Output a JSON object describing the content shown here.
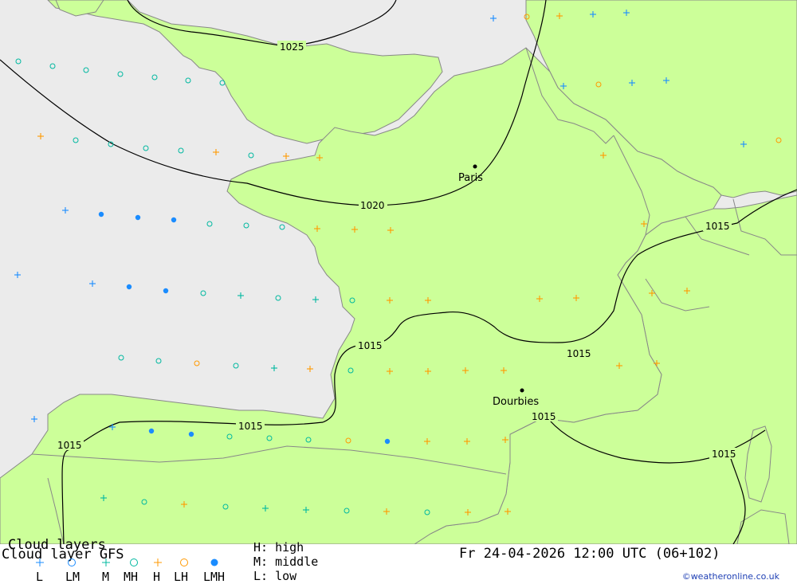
{
  "map": {
    "colors": {
      "sea": "#ebebeb",
      "land": "#ccff99",
      "border": "#888888",
      "isobar": "#000000",
      "low": "#1a8cff",
      "mid": "#00b8a0",
      "high": "#ff9900"
    },
    "cities": [
      {
        "name": "Paris"
      },
      {
        "name": "Dourbies"
      }
    ],
    "isobar_labels": [
      "1025",
      "1020",
      "1015",
      "1015",
      "1015",
      "1015",
      "1015",
      "1015",
      "1015"
    ]
  },
  "legend": {
    "title": "Cloud layers",
    "subtitle": "Cloud layer  GFS",
    "symbol_labels": [
      "L",
      "LM",
      "M",
      "MH",
      "H",
      "LH",
      "LMH"
    ],
    "key": {
      "h": "H: high",
      "m": "M: middle",
      "l": "L: low"
    },
    "timestamp": "Fr 24-04-2026 12:00 UTC (06+102)",
    "credit": "©weatheronline.co.uk"
  }
}
